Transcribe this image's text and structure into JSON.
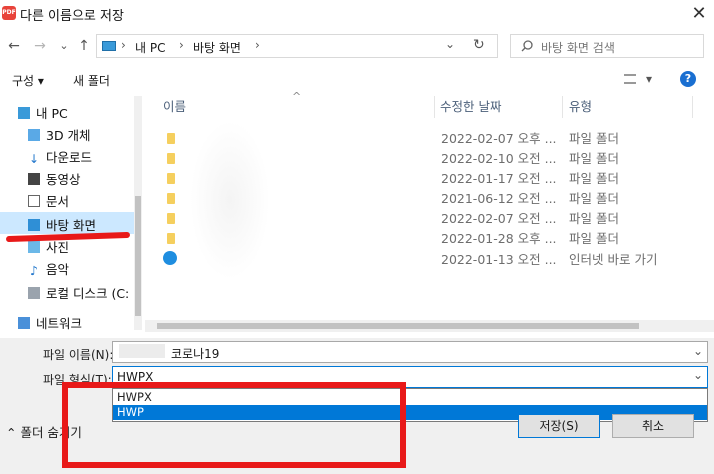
{
  "window": {
    "app_icon_text": "PDF",
    "title": "다른 이름으로 저장",
    "close": "✕"
  },
  "address": {
    "back": "←",
    "forward": "→",
    "dropdown": "⌄",
    "up": "↑",
    "crumbs": [
      "내 PC",
      "바탕 화면"
    ],
    "sep": "›",
    "refresh": "↻",
    "search_placeholder": "바탕 화면 검색"
  },
  "toolbar": {
    "organize": "구성 ▾",
    "new_folder": "새 폴더",
    "view": "▾",
    "help": "?"
  },
  "nav": {
    "items": [
      {
        "label": "내 PC",
        "icon": "pc-icon"
      },
      {
        "label": "3D 개체",
        "icon": "cube-icon"
      },
      {
        "label": "다운로드",
        "icon": "download-icon"
      },
      {
        "label": "동영상",
        "icon": "video-icon"
      },
      {
        "label": "문서",
        "icon": "document-icon"
      },
      {
        "label": "바탕 화면",
        "icon": "desktop-icon"
      },
      {
        "label": "사진",
        "icon": "picture-icon"
      },
      {
        "label": "음악",
        "icon": "music-icon"
      },
      {
        "label": "로컬 디스크 (C:",
        "icon": "disk-icon"
      },
      {
        "label": "네트워크",
        "icon": "network-icon"
      }
    ]
  },
  "columns": {
    "name": "이름",
    "modified": "수정한 날짜",
    "type": "유형",
    "sort_arrow": "^"
  },
  "files": [
    {
      "date": "2022-02-07 오후 ...",
      "type": "파일 폴더"
    },
    {
      "date": "2022-02-10 오전 ...",
      "type": "파일 폴더"
    },
    {
      "date": "2022-01-17 오전 ...",
      "type": "파일 폴더"
    },
    {
      "date": "2021-06-12 오전 ...",
      "type": "파일 폴더"
    },
    {
      "date": "2022-02-07 오전 ...",
      "type": "파일 폴더"
    },
    {
      "date": "2022-01-28 오후 ...",
      "type": "파일 폴더"
    },
    {
      "date": "2022-01-13 오전 ...",
      "type": "인터넷 바로 가기"
    }
  ],
  "form": {
    "filename_label": "파일 이름(N):",
    "filename_value": "코로나19",
    "filetype_label": "파일 형식(T):",
    "filetype_value": "HWPX",
    "options": [
      "HWPX",
      "HWP"
    ],
    "selected_option": "HWP"
  },
  "buttons": {
    "hide_folders": "⌃ 폴더 숨기기",
    "save": "저장(S)",
    "cancel": "취소"
  },
  "colors": {
    "accent": "#0078d7",
    "highlight": "#e81919",
    "selected_nav": "#cce8ff"
  }
}
